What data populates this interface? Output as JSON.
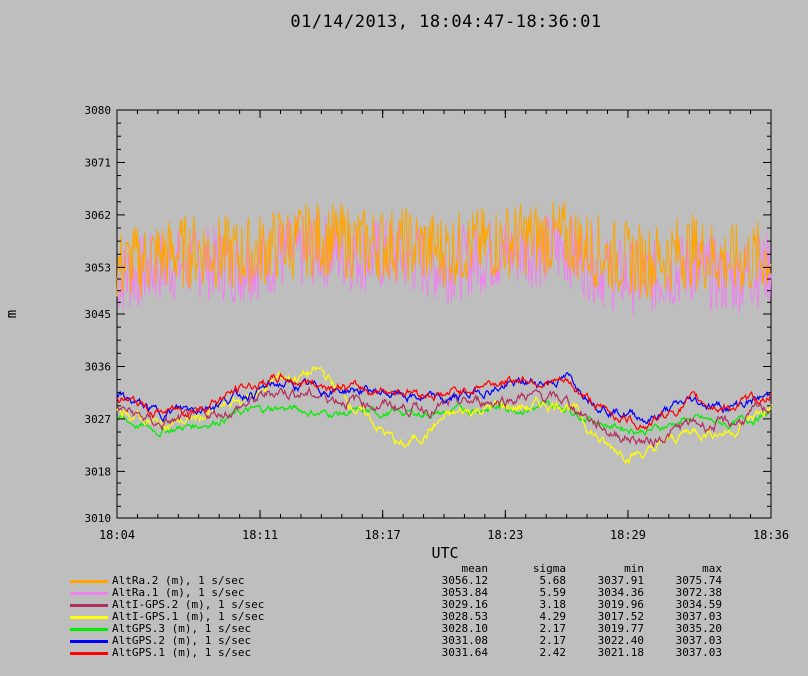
{
  "chart_data": {
    "type": "line",
    "title": "01/14/2013, 18:04:47-18:36:01",
    "xlabel": "UTC",
    "ylabel": "m",
    "ylim": [
      3010,
      3080
    ],
    "xlim": [
      "18:04",
      "18:36"
    ],
    "yticks": [
      "3010",
      "3018",
      "3027",
      "3036",
      "3045",
      "3053",
      "3062",
      "3071",
      "3080"
    ],
    "xticks": [
      "18:04",
      "18:11",
      "18:17",
      "18:23",
      "18:29",
      "18:36"
    ],
    "legend_headers": {
      "mean": "mean",
      "sigma": "sigma",
      "min": "min",
      "max": "max"
    },
    "series": [
      {
        "name": "AltRa.2 (m), 1 s/sec",
        "color": "#ffa500",
        "mean": "3056.12",
        "sigma": "5.68",
        "min": "3037.91",
        "max": "3075.74",
        "x": [
          "18:04",
          "18:06",
          "18:08",
          "18:10",
          "18:12",
          "18:14",
          "18:16",
          "18:18",
          "18:20",
          "18:22",
          "18:24",
          "18:26",
          "18:28",
          "18:30",
          "18:32",
          "18:34",
          "18:36"
        ],
        "values": [
          3053,
          3055,
          3056,
          3055,
          3057,
          3058,
          3057,
          3057,
          3056,
          3057,
          3058,
          3058,
          3055,
          3054,
          3056,
          3054,
          3055
        ]
      },
      {
        "name": "AltRa.1 (m), 1 s/sec",
        "color": "#ee82ee",
        "mean": "3053.84",
        "sigma": "5.59",
        "min": "3034.36",
        "max": "3072.38",
        "x": [
          "18:04",
          "18:06",
          "18:08",
          "18:10",
          "18:12",
          "18:14",
          "18:16",
          "18:18",
          "18:20",
          "18:22",
          "18:24",
          "18:26",
          "18:28",
          "18:30",
          "18:32",
          "18:34",
          "18:36"
        ],
        "values": [
          3051,
          3053,
          3054,
          3053,
          3055,
          3056,
          3055,
          3055,
          3053,
          3055,
          3056,
          3056,
          3052,
          3051,
          3053,
          3051,
          3053
        ]
      },
      {
        "name": "AltI-GPS.2 (m), 1 s/sec",
        "color": "#b03060",
        "mean": "3029.16",
        "sigma": "3.18",
        "min": "3019.96",
        "max": "3034.59",
        "x": [
          "18:04",
          "18:06",
          "18:08",
          "18:10",
          "18:12",
          "18:14",
          "18:16",
          "18:18",
          "18:20",
          "18:22",
          "18:24",
          "18:26",
          "18:28",
          "18:30",
          "18:32",
          "18:34",
          "18:36"
        ],
        "values": [
          3029,
          3026,
          3027,
          3029,
          3032,
          3031,
          3030,
          3029,
          3029,
          3030,
          3031,
          3030,
          3025,
          3023,
          3026,
          3026,
          3029
        ]
      },
      {
        "name": "AltI-GPS.1 (m), 1 s/sec",
        "color": "#ffff00",
        "mean": "3028.53",
        "sigma": "4.29",
        "min": "3017.52",
        "max": "3037.03",
        "x": [
          "18:04",
          "18:06",
          "18:08",
          "18:10",
          "18:12",
          "18:14",
          "18:16",
          "18:18",
          "18:20",
          "18:22",
          "18:24",
          "18:26",
          "18:28",
          "18:30",
          "18:32",
          "18:34",
          "18:36"
        ],
        "values": [
          3029,
          3026,
          3027,
          3030,
          3034,
          3035,
          3028,
          3022,
          3027,
          3029,
          3029,
          3030,
          3022,
          3021,
          3025,
          3025,
          3029
        ]
      },
      {
        "name": "AltGPS.3 (m), 1 s/sec",
        "color": "#00ee00",
        "mean": "3028.10",
        "sigma": "2.17",
        "min": "3019.77",
        "max": "3035.20",
        "x": [
          "18:04",
          "18:06",
          "18:08",
          "18:10",
          "18:12",
          "18:14",
          "18:16",
          "18:18",
          "18:20",
          "18:22",
          "18:24",
          "18:26",
          "18:28",
          "18:30",
          "18:32",
          "18:34",
          "18:36"
        ],
        "values": [
          3027,
          3025,
          3026,
          3028,
          3029,
          3028,
          3028,
          3028,
          3028,
          3029,
          3029,
          3029,
          3026,
          3025,
          3027,
          3026,
          3028
        ]
      },
      {
        "name": "AltGPS.2 (m), 1 s/sec",
        "color": "#0000ff",
        "mean": "3031.08",
        "sigma": "2.17",
        "min": "3022.40",
        "max": "3037.03",
        "x": [
          "18:04",
          "18:06",
          "18:08",
          "18:10",
          "18:12",
          "18:14",
          "18:16",
          "18:18",
          "18:20",
          "18:22",
          "18:24",
          "18:26",
          "18:28",
          "18:30",
          "18:32",
          "18:34",
          "18:36"
        ],
        "values": [
          3031,
          3028,
          3029,
          3031,
          3033,
          3032,
          3032,
          3031,
          3030,
          3032,
          3033,
          3034,
          3029,
          3027,
          3030,
          3029,
          3031
        ]
      },
      {
        "name": "AltGPS.1 (m), 1 s/sec",
        "color": "#ff0000",
        "mean": "3031.64",
        "sigma": "2.42",
        "min": "3021.18",
        "max": "3037.03",
        "x": [
          "18:04",
          "18:06",
          "18:08",
          "18:10",
          "18:12",
          "18:14",
          "18:16",
          "18:18",
          "18:20",
          "18:22",
          "18:24",
          "18:26",
          "18:28",
          "18:30",
          "18:32",
          "18:34",
          "18:36"
        ],
        "values": [
          3031,
          3028,
          3029,
          3032,
          3034,
          3033,
          3032,
          3032,
          3031,
          3033,
          3034,
          3033,
          3028,
          3026,
          3030,
          3029,
          3031
        ]
      }
    ]
  }
}
